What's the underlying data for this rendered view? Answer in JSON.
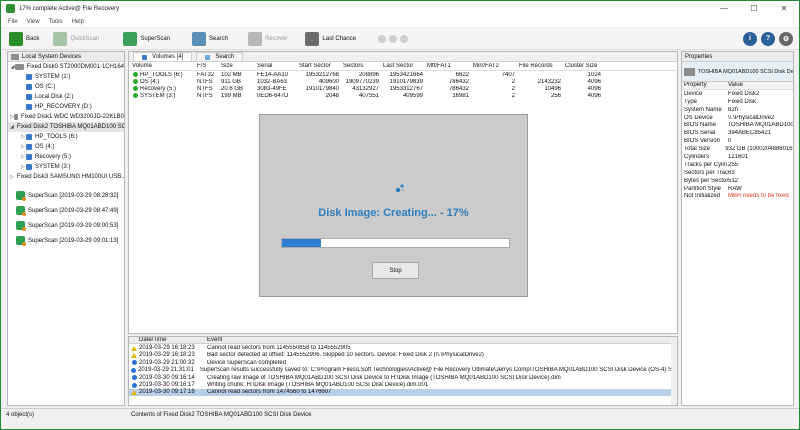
{
  "window": {
    "title": "17% complete Active@ File Recovery",
    "controls": [
      "—",
      "☐",
      "✕"
    ]
  },
  "menu": [
    "File",
    "View",
    "Tools",
    "Help"
  ],
  "toolbar": {
    "back": "Back",
    "quickscan": "QuickScan",
    "superscan": "SuperScan",
    "search": "Search",
    "recover": "Recover",
    "last_chance": "Last Chance"
  },
  "left_panel": {
    "header": "Local System Devices",
    "tree": [
      {
        "label": "Fixed Disk0 ST2000DM001-1CH164",
        "level": 0,
        "type": "disk",
        "arrow": "◢"
      },
      {
        "label": "SYSTEM (1:)",
        "level": 1,
        "type": "part"
      },
      {
        "label": "OS (C:)",
        "level": 1,
        "type": "part"
      },
      {
        "label": "Local Disk (2:)",
        "level": 1,
        "type": "part"
      },
      {
        "label": "HP_RECOVERY (D:)",
        "level": 1,
        "type": "part"
      },
      {
        "label": "Fixed Disk1 WDC WD3200JD-22KLB0",
        "level": 0,
        "type": "disk",
        "arrow": "▷"
      },
      {
        "label": "Fixed Disk2 TOSHIBA MQ01ABD100 SCSI...",
        "level": 0,
        "type": "disk",
        "arrow": "◢",
        "selected": true
      },
      {
        "label": "HP_TOOLS (6:)",
        "level": 1,
        "type": "part",
        "arrow": "▷"
      },
      {
        "label": "OS (4:)",
        "level": 1,
        "type": "part",
        "arrow": "▷"
      },
      {
        "label": "Recovery (5:)",
        "level": 1,
        "type": "part",
        "arrow": "▷"
      },
      {
        "label": "SYSTEM (3:)",
        "level": 1,
        "type": "part",
        "arrow": "▷"
      },
      {
        "label": "Fixed Disk3 SAMSUNG HM100UI USB...",
        "level": 0,
        "type": "disk",
        "arrow": "▷"
      }
    ],
    "superscans": [
      "SuperScan [2019-03-29 08:28:32]",
      "SuperScan [2019-03-29 08:47:49]",
      "SuperScan [2019-03-29 09:00:53]",
      "SuperScan [2019-03-29 09:01:13]"
    ]
  },
  "tabs": [
    "Volumes [4]",
    "Search"
  ],
  "volumes": {
    "columns": [
      "Volume",
      "F/S",
      "Size",
      "Serial",
      "Start Sector",
      "Sectors",
      "Last Sector",
      "Mft/FAT1",
      "Mirr/FAT2",
      "File Records",
      "Cluster Size"
    ],
    "rows": [
      [
        "HP_TOOLS (6:)",
        "FAT32",
        "102 MB",
        "FE14-AA10",
        "1953212768",
        "208896",
        "1953421664",
        "6622",
        "7407",
        "",
        "1024"
      ],
      [
        "OS (4:)",
        "NTFS",
        "911 GB",
        "1032-BA63",
        "409600",
        "1909770239",
        "1910179839",
        "786432",
        "2",
        "2143232",
        "4096"
      ],
      [
        "Recovery (5:)",
        "NTFS",
        "20.6 GB",
        "3083-49FE",
        "1910179840",
        "43132927",
        "1953312767",
        "786432",
        "2",
        "10496",
        "4096"
      ],
      [
        "SYSTEM (3:)",
        "NTFS",
        "199 MB",
        "0ED6-647D",
        "2048",
        "407551",
        "409599",
        "16981",
        "2",
        "256",
        "4096"
      ]
    ]
  },
  "modal": {
    "title": "Disk Image: Creating... - 17%",
    "progress": 17,
    "stop": "Stop"
  },
  "log": {
    "columns": [
      "Date/Time",
      "Event"
    ],
    "rows": [
      {
        "type": "warn",
        "time": "2019-03-29 16:18:23",
        "event": "Cannot read sectors from 1145550858 to 1145552905"
      },
      {
        "type": "warn",
        "time": "2019-03-29 16:18:23",
        "event": "Bad sector detected at offset: 1145552906. Skipped 10 sectors. Device: Fixed Disk 2 (\\\\.\\PhysicalDrive2)"
      },
      {
        "type": "info",
        "time": "2019-03-29 21:00:32",
        "event": "Device SuperScan completed"
      },
      {
        "type": "info",
        "time": "2019-03-29 21:31:01",
        "event": "SuperScan results successfully saved to: C:\\Program Files\\LSoft Technologies\\Active@ File Recovery Ultimate\\Jerrys Comp\\TOSHIBA MQ01ABD100 SCSI Disk Device (OS-4) SuperScan [2019-0..."
      },
      {
        "type": "info",
        "time": "2019-03-30 09:16:14",
        "event": "Creating raw image of TOSHIBA MQ01ABD100 SCSI Disk Device to H:\\Disk Image (TOSHIBA MQ01ABD100 SCSI Disk Device).dim"
      },
      {
        "type": "info",
        "time": "2019-03-30 09:16:17",
        "event": "Writing chunk: H:\\Disk Image (TOSHIBA MQ01ABD100 SCSI Disk Device).dim.001"
      },
      {
        "type": "warn",
        "time": "2019-03-30 09:17:18",
        "event": "Cannot read sectors from 1474560 to 1476607",
        "highlight": true
      }
    ]
  },
  "properties": {
    "header": "Properties",
    "device_name": "TOSHIBA MQ01ABD100 SCSI Disk Device",
    "columns": [
      "Property",
      "Value"
    ],
    "rows": [
      [
        "Device",
        "Fixed Disk2"
      ],
      [
        "Type",
        "Fixed Disk"
      ],
      [
        "System Name",
        "82h"
      ],
      [
        "OS Device",
        "\\\\.\\PhysicalDrive2"
      ],
      [
        "BIOS Name",
        "TOSHIBA MQ01ABD100"
      ],
      [
        "BIOS Serial",
        "394ABEC85421"
      ],
      [
        "BIOS Version",
        "0"
      ],
      [
        "Total Size",
        "932 GB (1000204886016..."
      ],
      [
        "Cylinders",
        "121601"
      ],
      [
        "Tracks per Cylin...",
        "255"
      ],
      [
        "Sectors per Track",
        "63"
      ],
      [
        "Bytes per Sector",
        "512"
      ],
      [
        "Partition Style",
        "RAW"
      ],
      [
        "Not Initialized",
        "MBR needs to be fixed"
      ]
    ]
  },
  "status": {
    "left": "4 object(s)",
    "right": "Contents of Fixed Disk2 TOSHIBA MQ01ABD100 SCSI Disk Device"
  },
  "colors": {
    "accent": "#2f7fbd",
    "progress": "#2f7fd1",
    "warning": "#e03a1e",
    "selection": "#cfe4f7"
  }
}
